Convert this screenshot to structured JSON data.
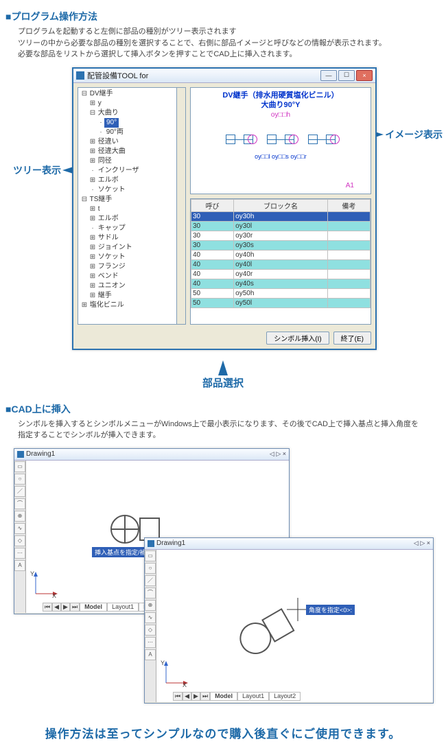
{
  "sect1": {
    "head": "■プログラム操作方法",
    "line1": "プログラムを起動すると左側に部品の種別がツリー表示されます",
    "line2": "ツリーの中から必要な部品の種別を選択することで、右側に部品イメージと呼びなどの情報が表示されます。",
    "line3": "必要な部品をリストから選択して挿入ボタンを押すことでCAD上に挿入されます。"
  },
  "toolwin": {
    "title": "配管設備TOOL for",
    "preview_title1": "DV継手（排水用硬質塩化ビニル）",
    "preview_title2": "大曲り90°Y",
    "preview_sub": "oy□□h",
    "preview_labels": "oy□□l  oy□□s  oy□□r",
    "preview_a1": "A1",
    "btn_insert": "シンボル挿入(I)",
    "btn_close": "終了(E)"
  },
  "tree": [
    {
      "lv": 0,
      "pre": "⊟",
      "txt": "DV継手"
    },
    {
      "lv": 1,
      "pre": "⊞",
      "txt": "y"
    },
    {
      "lv": 1,
      "pre": "⊟",
      "txt": "大曲り"
    },
    {
      "lv": 2,
      "pre": "",
      "txt": "90°",
      "sel": true
    },
    {
      "lv": 2,
      "pre": "",
      "txt": "90°両"
    },
    {
      "lv": 1,
      "pre": "⊞",
      "txt": "径違い"
    },
    {
      "lv": 1,
      "pre": "⊞",
      "txt": "径違大曲"
    },
    {
      "lv": 1,
      "pre": "⊞",
      "txt": "同径"
    },
    {
      "lv": 1,
      "pre": "",
      "txt": "インクリーザ"
    },
    {
      "lv": 1,
      "pre": "⊞",
      "txt": "エルボ"
    },
    {
      "lv": 1,
      "pre": "",
      "txt": "ソケット"
    },
    {
      "lv": 0,
      "pre": "⊟",
      "txt": "TS継手"
    },
    {
      "lv": 1,
      "pre": "⊞",
      "txt": "t"
    },
    {
      "lv": 1,
      "pre": "⊞",
      "txt": "エルボ"
    },
    {
      "lv": 1,
      "pre": "",
      "txt": "キャップ"
    },
    {
      "lv": 1,
      "pre": "⊞",
      "txt": "サドル"
    },
    {
      "lv": 1,
      "pre": "⊞",
      "txt": "ジョイント"
    },
    {
      "lv": 1,
      "pre": "⊞",
      "txt": "ソケット"
    },
    {
      "lv": 1,
      "pre": "⊞",
      "txt": "フランジ"
    },
    {
      "lv": 1,
      "pre": "⊞",
      "txt": "ベンド"
    },
    {
      "lv": 1,
      "pre": "⊞",
      "txt": "ユニオン"
    },
    {
      "lv": 1,
      "pre": "⊞",
      "txt": "継手"
    },
    {
      "lv": 0,
      "pre": "⊞",
      "txt": "塩化ビニル"
    }
  ],
  "table": {
    "cols": [
      "呼び",
      "ブロック名",
      "備考"
    ],
    "rows": [
      {
        "c": [
          "30",
          "oy30h",
          ""
        ],
        "sel": true
      },
      {
        "c": [
          "30",
          "oy30l",
          ""
        ],
        "hi": true
      },
      {
        "c": [
          "30",
          "oy30r",
          ""
        ]
      },
      {
        "c": [
          "30",
          "oy30s",
          ""
        ],
        "hi": true
      },
      {
        "c": [
          "40",
          "oy40h",
          ""
        ]
      },
      {
        "c": [
          "40",
          "oy40l",
          ""
        ],
        "hi": true
      },
      {
        "c": [
          "40",
          "oy40r",
          ""
        ]
      },
      {
        "c": [
          "40",
          "oy40s",
          ""
        ],
        "hi": true
      },
      {
        "c": [
          "50",
          "oy50h",
          ""
        ]
      },
      {
        "c": [
          "50",
          "oy50l",
          ""
        ],
        "hi": true
      }
    ]
  },
  "callouts": {
    "tree": "ツリー表示",
    "image": "イメージ表示",
    "select": "部品選択"
  },
  "sect2": {
    "head": "■CAD上に挿入",
    "line1": "シンボルを挿入するとシンボルメニューがWindows上で最小表示になります、その後でCAD上で挿入基点と挿入角度を",
    "line2": "指定することでシンボルが挿入できます。"
  },
  "cad": {
    "title": "Drawing1",
    "tabs": {
      "model": "Model",
      "l1": "Layout1",
      "l2": "Layout2"
    },
    "axis": {
      "x": "X",
      "y": "Y"
    },
    "prompt1": "挿入基点を指定/補助(M)/尺度を指定/XYZ/角度を指定>:",
    "prompt2": "角度を指定<0>:"
  },
  "bottom": "操作方法は至ってシンプルなので購入後直ぐにご使用できます。"
}
